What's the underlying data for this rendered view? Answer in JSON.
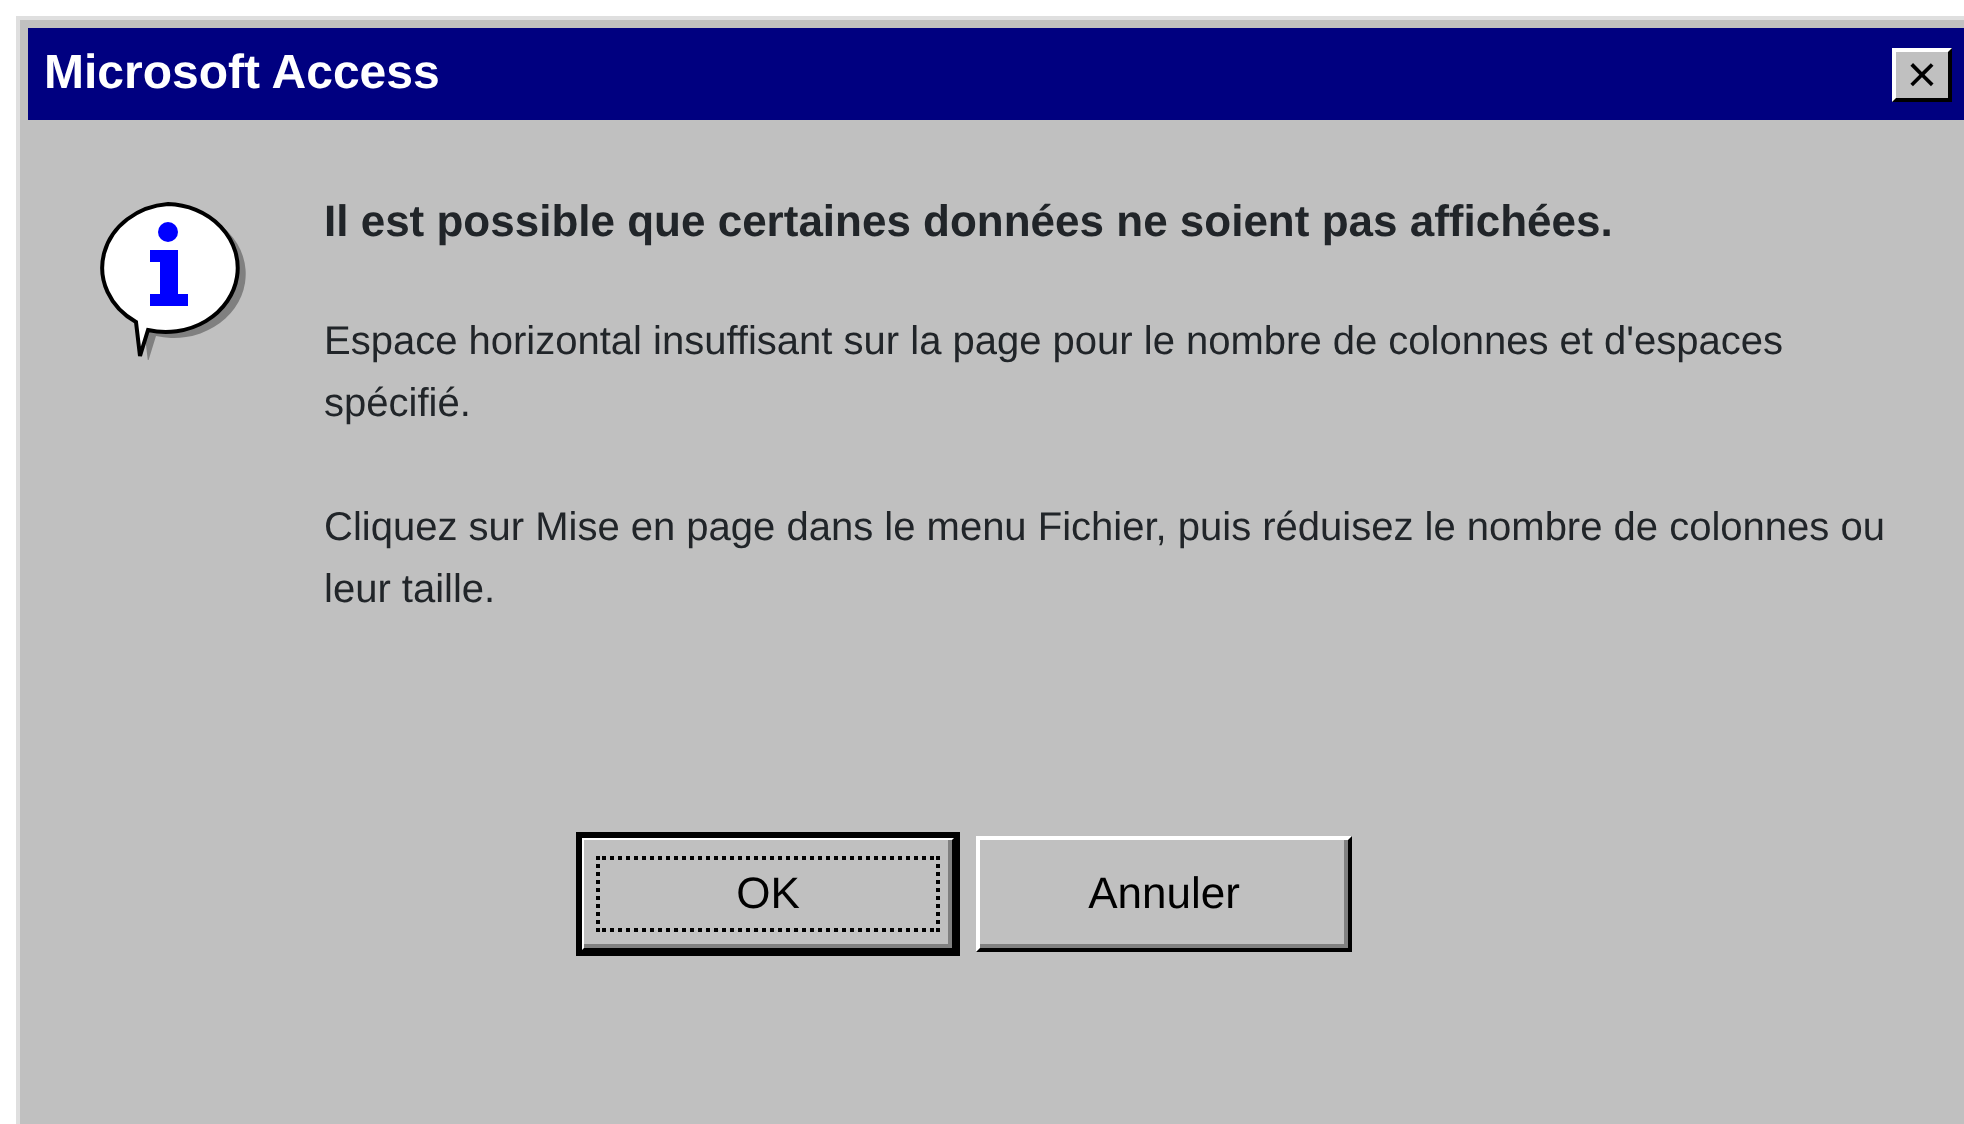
{
  "window": {
    "title": "Microsoft Access",
    "close": "×"
  },
  "message": {
    "heading": "Il est possible que certaines données ne soient pas affichées.",
    "paragraphs": [
      "Espace horizontal insuffisant sur la page pour le nombre de colonnes et d'espaces spécifié.",
      "Cliquez sur Mise en page dans le menu Fichier, puis réduisez le nombre de colonnes ou leur taille."
    ]
  },
  "buttons": [
    {
      "label": "OK",
      "default": true
    },
    {
      "label": "Annuler",
      "default": false
    }
  ]
}
